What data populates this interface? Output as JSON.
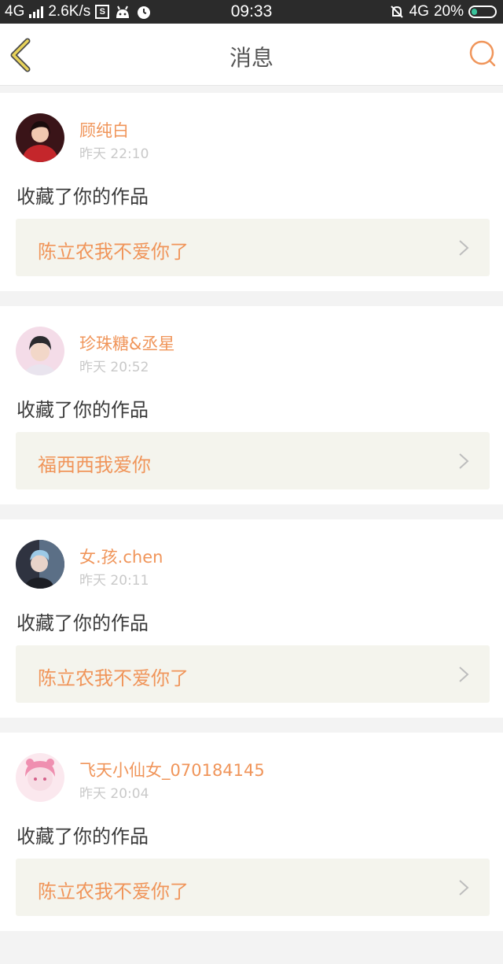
{
  "status_bar": {
    "network": "4G",
    "speed": "2.6K/s",
    "s_badge": "S",
    "time": "09:33",
    "network_right": "4G",
    "battery": "20%",
    "battery_level": 0.2
  },
  "header": {
    "title": "消息",
    "back_icon": "chevron-left-icon",
    "search_icon": "search-icon"
  },
  "notifications": [
    {
      "user": "顾纯白",
      "time": "昨天 22:10",
      "action": "收藏了你的作品",
      "work_title": "陈立农我不爱你了",
      "avatar_colors": [
        "#3a1418",
        "#c4262b",
        "#f0c8b0"
      ]
    },
    {
      "user": "珍珠糖&丞星",
      "time": "昨天 20:52",
      "action": "收藏了你的作品",
      "work_title": "福西西我爱你",
      "avatar_colors": [
        "#f4dce8",
        "#2b2b2e",
        "#f2d7c8"
      ]
    },
    {
      "user": "女.孩.chen",
      "time": "昨天 20:11",
      "action": "收藏了你的作品",
      "work_title": "陈立农我不爱你了",
      "avatar_colors": [
        "#2f3340",
        "#9cc9e6",
        "#e8d3c9"
      ]
    },
    {
      "user": "飞天小仙女_070184145",
      "time": "昨天 20:04",
      "action": "收藏了你的作品",
      "work_title": "陈立农我不爱你了",
      "avatar_colors": [
        "#f7dce4",
        "#ef8fb0",
        "#fbe8ee"
      ]
    }
  ],
  "colors": {
    "accent": "#f0955a",
    "time_gray": "#c9c9c9",
    "card_bg": "#f4f4ed",
    "page_bg": "#f3f3f3"
  }
}
